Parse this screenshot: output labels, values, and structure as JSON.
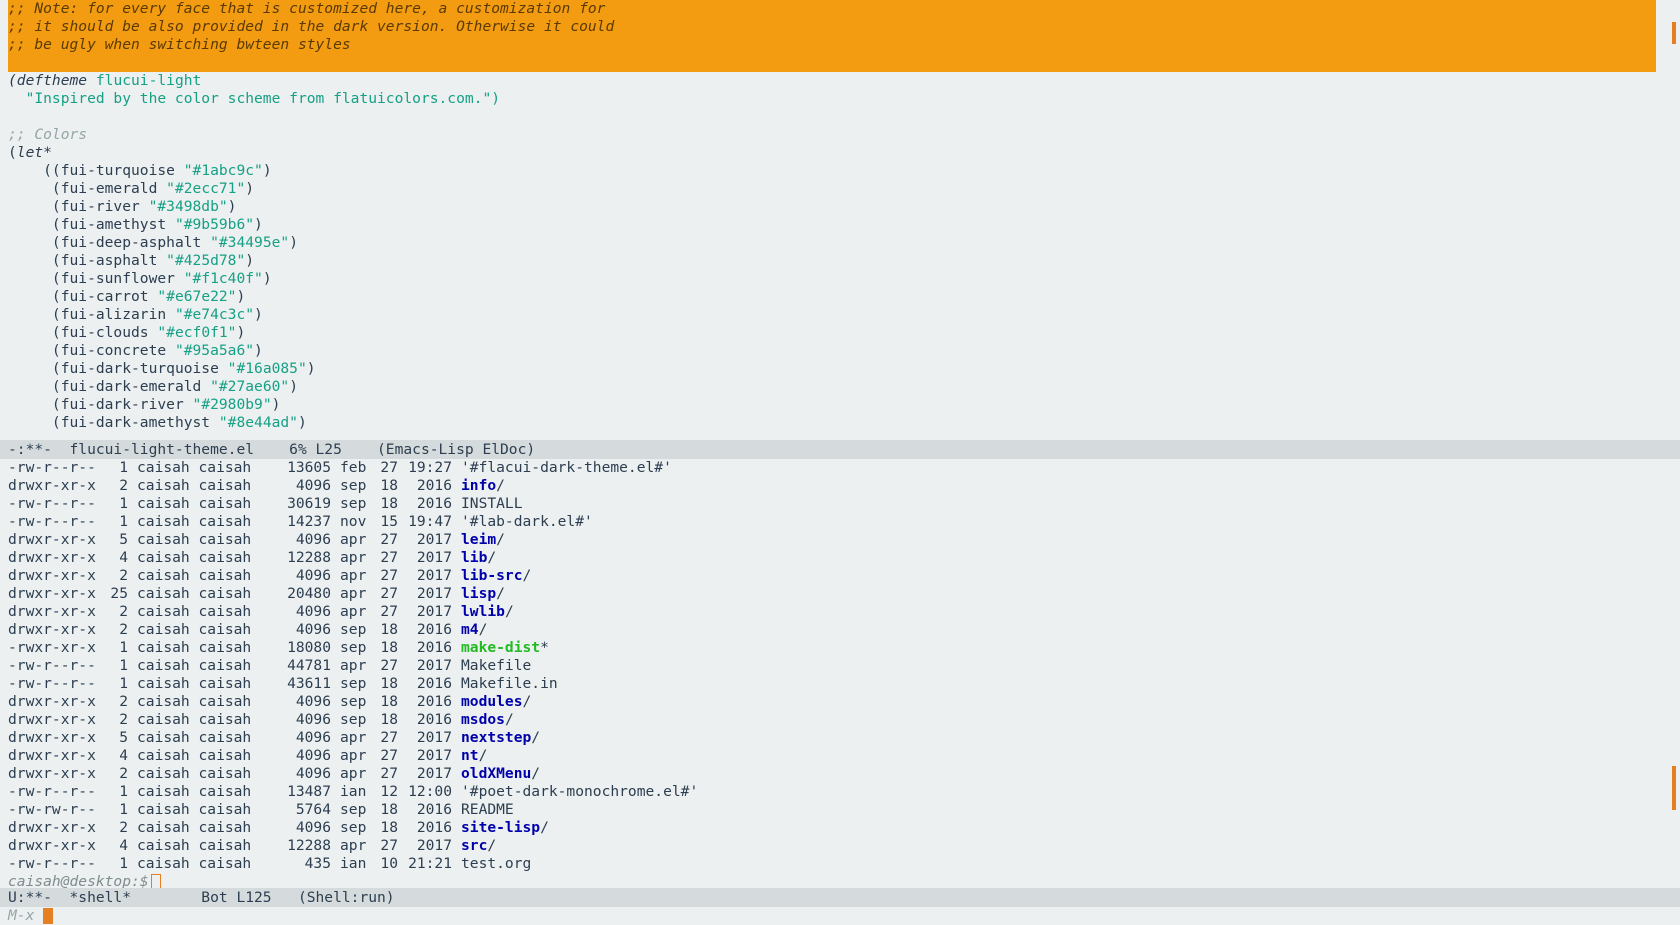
{
  "top_buffer": {
    "note_lines": [
      ";; Note: for every face that is customized here, a customization for",
      ";; it should be also provided in the dark version. Otherwise it could",
      ";; be ugly when switching bwteen styles"
    ],
    "deftheme_kw": "(deftheme",
    "theme_name": "flucui-light",
    "docstring": "  \"Inspired by the color scheme from flatuicolors.com.\")",
    "colors_comment": ";; Colors",
    "let_open": "(",
    "let_kw": "let*",
    "colors": [
      {
        "prefix": "    ((",
        "name": "fui-turquoise",
        "value": "\"#1abc9c\"",
        "suffix": ")"
      },
      {
        "prefix": "     (",
        "name": "fui-emerald",
        "value": "\"#2ecc71\"",
        "suffix": ")"
      },
      {
        "prefix": "     (",
        "name": "fui-river",
        "value": "\"#3498db\"",
        "suffix": ")"
      },
      {
        "prefix": "     (",
        "name": "fui-amethyst",
        "value": "\"#9b59b6\"",
        "suffix": ")"
      },
      {
        "prefix": "     (",
        "name": "fui-deep-asphalt",
        "value": "\"#34495e\"",
        "suffix": ")"
      },
      {
        "prefix": "     (",
        "name": "fui-asphalt",
        "value": "\"#425d78\"",
        "suffix": ")"
      },
      {
        "prefix": "     (",
        "name": "fui-sunflower",
        "value": "\"#f1c40f\"",
        "suffix": ")"
      },
      {
        "prefix": "     (",
        "name": "fui-carrot",
        "value": "\"#e67e22\"",
        "suffix": ")"
      },
      {
        "prefix": "     (",
        "name": "fui-alizarin",
        "value": "\"#e74c3c\"",
        "suffix": ")"
      },
      {
        "prefix": "     (",
        "name": "fui-clouds",
        "value": "\"#ecf0f1\"",
        "suffix": ")"
      },
      {
        "prefix": "     (",
        "name": "fui-concrete",
        "value": "\"#95a5a6\"",
        "suffix": ")"
      },
      {
        "prefix": "     (",
        "name": "fui-dark-turquoise",
        "value": "\"#16a085\"",
        "suffix": ")"
      },
      {
        "prefix": "     (",
        "name": "fui-dark-emerald",
        "value": "\"#27ae60\"",
        "suffix": ")"
      },
      {
        "prefix": "     (",
        "name": "fui-dark-river",
        "value": "\"#2980b9\"",
        "suffix": ")"
      },
      {
        "prefix": "     (",
        "name": "fui-dark-amethyst",
        "value": "\"#8e44ad\"",
        "suffix": ")"
      }
    ]
  },
  "modeline_top": "-:**-  flucui-light-theme.el    6% L25    (Emacs-Lisp ElDoc)",
  "listing": [
    {
      "perm": "-rw-r--r--",
      "links": "1",
      "owner": "caisah caisah",
      "size": "13605",
      "month": "feb",
      "day": "27",
      "time": "19:27",
      "name": "'#flacui-dark-theme.el#'",
      "kind": "file",
      "suffix": ""
    },
    {
      "perm": "drwxr-xr-x",
      "links": "2",
      "owner": "caisah caisah",
      "size": "4096",
      "month": "sep",
      "day": "18",
      "time": "2016",
      "name": "info",
      "kind": "dir",
      "suffix": "/"
    },
    {
      "perm": "-rw-r--r--",
      "links": "1",
      "owner": "caisah caisah",
      "size": "30619",
      "month": "sep",
      "day": "18",
      "time": "2016",
      "name": "INSTALL",
      "kind": "file",
      "suffix": ""
    },
    {
      "perm": "-rw-r--r--",
      "links": "1",
      "owner": "caisah caisah",
      "size": "14237",
      "month": "nov",
      "day": "15",
      "time": "19:47",
      "name": "'#lab-dark.el#'",
      "kind": "file",
      "suffix": ""
    },
    {
      "perm": "drwxr-xr-x",
      "links": "5",
      "owner": "caisah caisah",
      "size": "4096",
      "month": "apr",
      "day": "27",
      "time": "2017",
      "name": "leim",
      "kind": "dir",
      "suffix": "/"
    },
    {
      "perm": "drwxr-xr-x",
      "links": "4",
      "owner": "caisah caisah",
      "size": "12288",
      "month": "apr",
      "day": "27",
      "time": "2017",
      "name": "lib",
      "kind": "dir",
      "suffix": "/"
    },
    {
      "perm": "drwxr-xr-x",
      "links": "2",
      "owner": "caisah caisah",
      "size": "4096",
      "month": "apr",
      "day": "27",
      "time": "2017",
      "name": "lib-src",
      "kind": "dir",
      "suffix": "/"
    },
    {
      "perm": "drwxr-xr-x",
      "links": "25",
      "owner": "caisah caisah",
      "size": "20480",
      "month": "apr",
      "day": "27",
      "time": "2017",
      "name": "lisp",
      "kind": "dir",
      "suffix": "/"
    },
    {
      "perm": "drwxr-xr-x",
      "links": "2",
      "owner": "caisah caisah",
      "size": "4096",
      "month": "apr",
      "day": "27",
      "time": "2017",
      "name": "lwlib",
      "kind": "dir",
      "suffix": "/"
    },
    {
      "perm": "drwxr-xr-x",
      "links": "2",
      "owner": "caisah caisah",
      "size": "4096",
      "month": "sep",
      "day": "18",
      "time": "2016",
      "name": "m4",
      "kind": "dir",
      "suffix": "/"
    },
    {
      "perm": "-rwxr-xr-x",
      "links": "1",
      "owner": "caisah caisah",
      "size": "18080",
      "month": "sep",
      "day": "18",
      "time": "2016",
      "name": "make-dist",
      "kind": "exe",
      "suffix": "*"
    },
    {
      "perm": "-rw-r--r--",
      "links": "1",
      "owner": "caisah caisah",
      "size": "44781",
      "month": "apr",
      "day": "27",
      "time": "2017",
      "name": "Makefile",
      "kind": "file",
      "suffix": ""
    },
    {
      "perm": "-rw-r--r--",
      "links": "1",
      "owner": "caisah caisah",
      "size": "43611",
      "month": "sep",
      "day": "18",
      "time": "2016",
      "name": "Makefile.in",
      "kind": "file",
      "suffix": ""
    },
    {
      "perm": "drwxr-xr-x",
      "links": "2",
      "owner": "caisah caisah",
      "size": "4096",
      "month": "sep",
      "day": "18",
      "time": "2016",
      "name": "modules",
      "kind": "dir",
      "suffix": "/"
    },
    {
      "perm": "drwxr-xr-x",
      "links": "2",
      "owner": "caisah caisah",
      "size": "4096",
      "month": "sep",
      "day": "18",
      "time": "2016",
      "name": "msdos",
      "kind": "dir",
      "suffix": "/"
    },
    {
      "perm": "drwxr-xr-x",
      "links": "5",
      "owner": "caisah caisah",
      "size": "4096",
      "month": "apr",
      "day": "27",
      "time": "2017",
      "name": "nextstep",
      "kind": "dir",
      "suffix": "/"
    },
    {
      "perm": "drwxr-xr-x",
      "links": "4",
      "owner": "caisah caisah",
      "size": "4096",
      "month": "apr",
      "day": "27",
      "time": "2017",
      "name": "nt",
      "kind": "dir",
      "suffix": "/"
    },
    {
      "perm": "drwxr-xr-x",
      "links": "2",
      "owner": "caisah caisah",
      "size": "4096",
      "month": "apr",
      "day": "27",
      "time": "2017",
      "name": "oldXMenu",
      "kind": "dir",
      "suffix": "/"
    },
    {
      "perm": "-rw-r--r--",
      "links": "1",
      "owner": "caisah caisah",
      "size": "13487",
      "month": "ian",
      "day": "12",
      "time": "12:00",
      "name": "'#poet-dark-monochrome.el#'",
      "kind": "file",
      "suffix": ""
    },
    {
      "perm": "-rw-rw-r--",
      "links": "1",
      "owner": "caisah caisah",
      "size": "5764",
      "month": "sep",
      "day": "18",
      "time": "2016",
      "name": "README",
      "kind": "file",
      "suffix": ""
    },
    {
      "perm": "drwxr-xr-x",
      "links": "2",
      "owner": "caisah caisah",
      "size": "4096",
      "month": "sep",
      "day": "18",
      "time": "2016",
      "name": "site-lisp",
      "kind": "dir",
      "suffix": "/"
    },
    {
      "perm": "drwxr-xr-x",
      "links": "4",
      "owner": "caisah caisah",
      "size": "12288",
      "month": "apr",
      "day": "27",
      "time": "2017",
      "name": "src",
      "kind": "dir",
      "suffix": "/"
    },
    {
      "perm": "-rw-r--r--",
      "links": "1",
      "owner": "caisah caisah",
      "size": "435",
      "month": "ian",
      "day": "10",
      "time": "21:21",
      "name": "test.org",
      "kind": "file",
      "suffix": ""
    }
  ],
  "shell_prompt": "caisah@desktop:$",
  "modeline_bottom": "U:**-  *shell*        Bot L125   (Shell:run)",
  "minibuffer_prompt": "M-x",
  "colors": {
    "note_bg": "#f39c12",
    "background": "#ecf0f1",
    "modeline_bg": "#d5dbdd",
    "dir_color": "#0000aa",
    "exe_color": "#22bb22",
    "string_color": "#16a085",
    "cursor_color": "#e67e22"
  }
}
